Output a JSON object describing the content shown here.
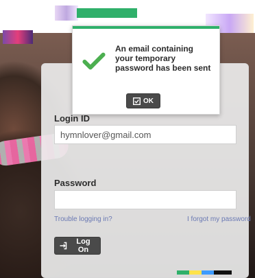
{
  "modal": {
    "message_lines": [
      "An email containing",
      "your temporary",
      "password has been sent"
    ],
    "ok_label": "OK"
  },
  "login": {
    "login_id_label": "Login ID",
    "login_id_value": "hymnlover@gmail.com",
    "password_label": "Password",
    "password_value": "",
    "trouble_link": "Trouble logging in?",
    "forgot_link": "I forgot my password",
    "logon_label": "Log On"
  },
  "colors": {
    "accent_green": "#2fb06a",
    "button_dark": "#4a4a4a",
    "link_blue": "#6a79b3"
  }
}
